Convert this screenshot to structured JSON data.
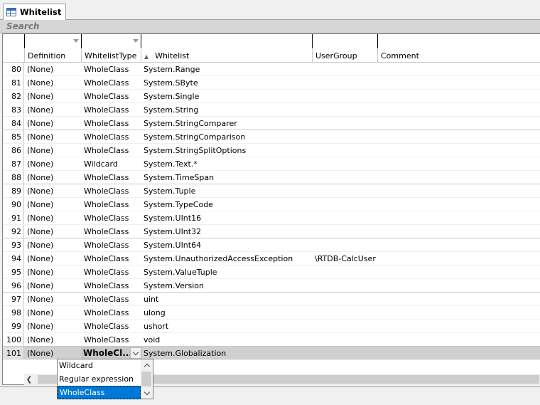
{
  "tab": {
    "title": "Whitelist",
    "icon": "table-icon"
  },
  "search": {
    "label": "Search"
  },
  "columns": [
    {
      "key": "definition",
      "label": "Definition",
      "has_filter_dropdown": true
    },
    {
      "key": "type",
      "label": "WhitelistType",
      "has_filter_dropdown": true
    },
    {
      "key": "whitelist",
      "label": "Whitelist",
      "sorted": "ascending",
      "sort_icon": "sort-ascending-icon"
    },
    {
      "key": "usergroup",
      "label": "UserGroup"
    },
    {
      "key": "comment",
      "label": "Comment"
    }
  ],
  "rows": [
    {
      "n": "80",
      "definition": "(None)",
      "type": "WholeClass",
      "whitelist": "System.Range",
      "usergroup": "",
      "comment": ""
    },
    {
      "n": "81",
      "definition": "(None)",
      "type": "WholeClass",
      "whitelist": "System.SByte",
      "usergroup": "",
      "comment": ""
    },
    {
      "n": "82",
      "definition": "(None)",
      "type": "WholeClass",
      "whitelist": "System.Single",
      "usergroup": "",
      "comment": ""
    },
    {
      "n": "83",
      "definition": "(None)",
      "type": "WholeClass",
      "whitelist": "System.String",
      "usergroup": "",
      "comment": ""
    },
    {
      "n": "84",
      "definition": "(None)",
      "type": "WholeClass",
      "whitelist": "System.StringComparer",
      "usergroup": "",
      "comment": ""
    },
    {
      "n": "85",
      "definition": "(None)",
      "type": "WholeClass",
      "whitelist": "System.StringComparison",
      "usergroup": "",
      "comment": ""
    },
    {
      "n": "86",
      "definition": "(None)",
      "type": "WholeClass",
      "whitelist": "System.StringSplitOptions",
      "usergroup": "",
      "comment": ""
    },
    {
      "n": "87",
      "definition": "(None)",
      "type": "Wildcard",
      "whitelist": "System.Text.*",
      "usergroup": "",
      "comment": ""
    },
    {
      "n": "88",
      "definition": "(None)",
      "type": "WholeClass",
      "whitelist": "System.TimeSpan",
      "usergroup": "",
      "comment": ""
    },
    {
      "n": "89",
      "definition": "(None)",
      "type": "WholeClass",
      "whitelist": "System.Tuple",
      "usergroup": "",
      "comment": ""
    },
    {
      "n": "90",
      "definition": "(None)",
      "type": "WholeClass",
      "whitelist": "System.TypeCode",
      "usergroup": "",
      "comment": ""
    },
    {
      "n": "91",
      "definition": "(None)",
      "type": "WholeClass",
      "whitelist": "System.UInt16",
      "usergroup": "",
      "comment": ""
    },
    {
      "n": "92",
      "definition": "(None)",
      "type": "WholeClass",
      "whitelist": "System.UInt32",
      "usergroup": "",
      "comment": ""
    },
    {
      "n": "93",
      "definition": "(None)",
      "type": "WholeClass",
      "whitelist": "System.UInt64",
      "usergroup": "",
      "comment": ""
    },
    {
      "n": "94",
      "definition": "(None)",
      "type": "WholeClass",
      "whitelist": "System.UnauthorizedAccessException",
      "usergroup": "\\RTDB-CalcUser",
      "comment": ""
    },
    {
      "n": "95",
      "definition": "(None)",
      "type": "WholeClass",
      "whitelist": "System.ValueTuple",
      "usergroup": "",
      "comment": ""
    },
    {
      "n": "96",
      "definition": "(None)",
      "type": "WholeClass",
      "whitelist": "System.Version",
      "usergroup": "",
      "comment": ""
    },
    {
      "n": "97",
      "definition": "(None)",
      "type": "WholeClass",
      "whitelist": "uint",
      "usergroup": "",
      "comment": ""
    },
    {
      "n": "98",
      "definition": "(None)",
      "type": "WholeClass",
      "whitelist": "ulong",
      "usergroup": "",
      "comment": ""
    },
    {
      "n": "99",
      "definition": "(None)",
      "type": "WholeClass",
      "whitelist": "ushort",
      "usergroup": "",
      "comment": ""
    },
    {
      "n": "100",
      "definition": "(None)",
      "type": "WholeClass",
      "whitelist": "void",
      "usergroup": "",
      "comment": ""
    }
  ],
  "edit_row": {
    "n": "101",
    "definition": "(None)",
    "type_value": "WholeCl...",
    "whitelist": "System.Globalization"
  },
  "type_dropdown": {
    "options": [
      "Wildcard",
      "Regular expression",
      "WholeClass"
    ],
    "selected": "WholeClass"
  }
}
